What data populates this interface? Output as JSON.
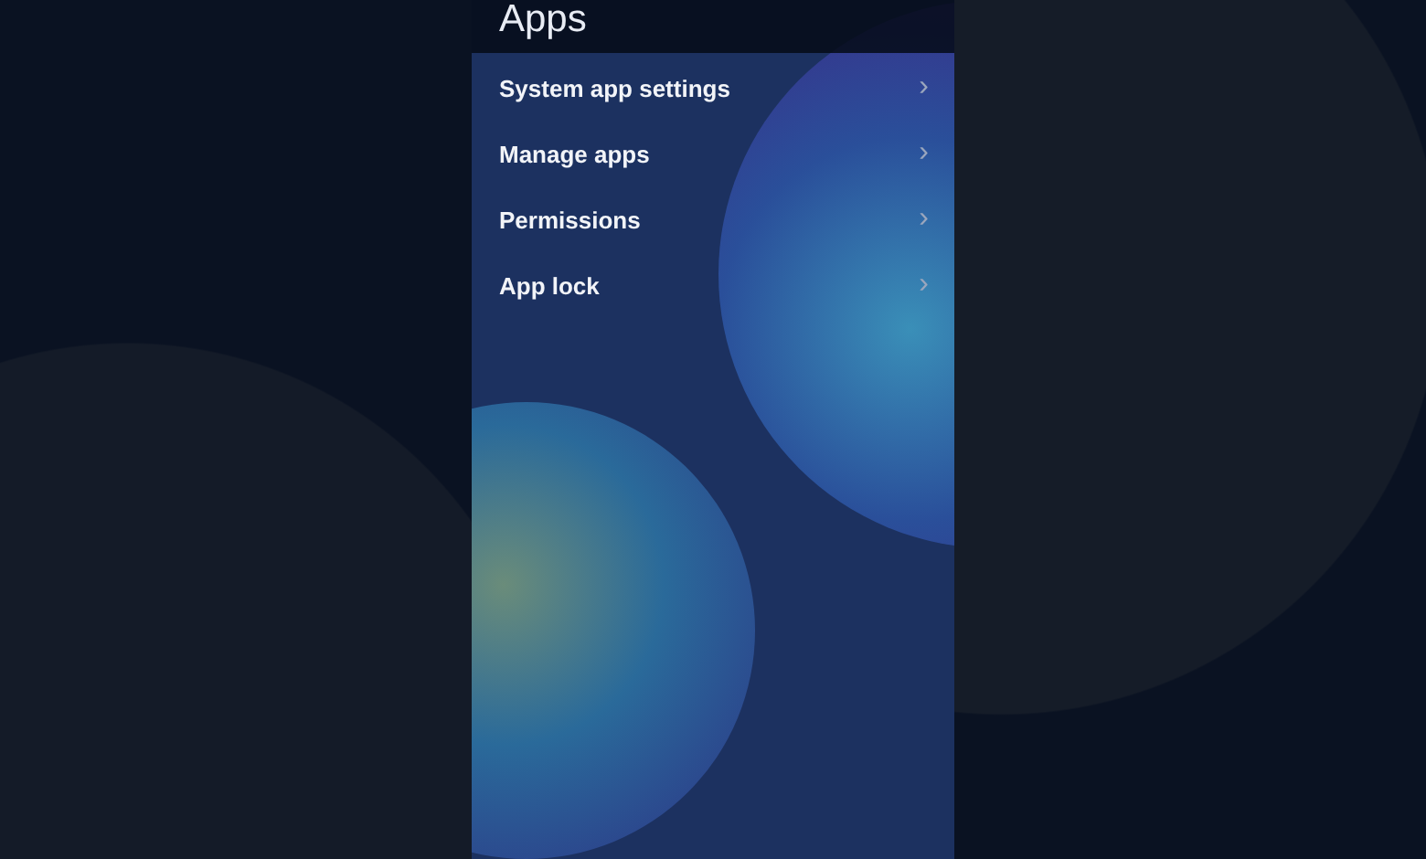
{
  "header": {
    "title": "Apps"
  },
  "menu": [
    {
      "label": "System app settings",
      "chevron": "›"
    },
    {
      "label": "Manage apps",
      "chevron": "›"
    },
    {
      "label": "Permissions",
      "chevron": "›"
    },
    {
      "label": "App lock",
      "chevron": "›"
    }
  ]
}
